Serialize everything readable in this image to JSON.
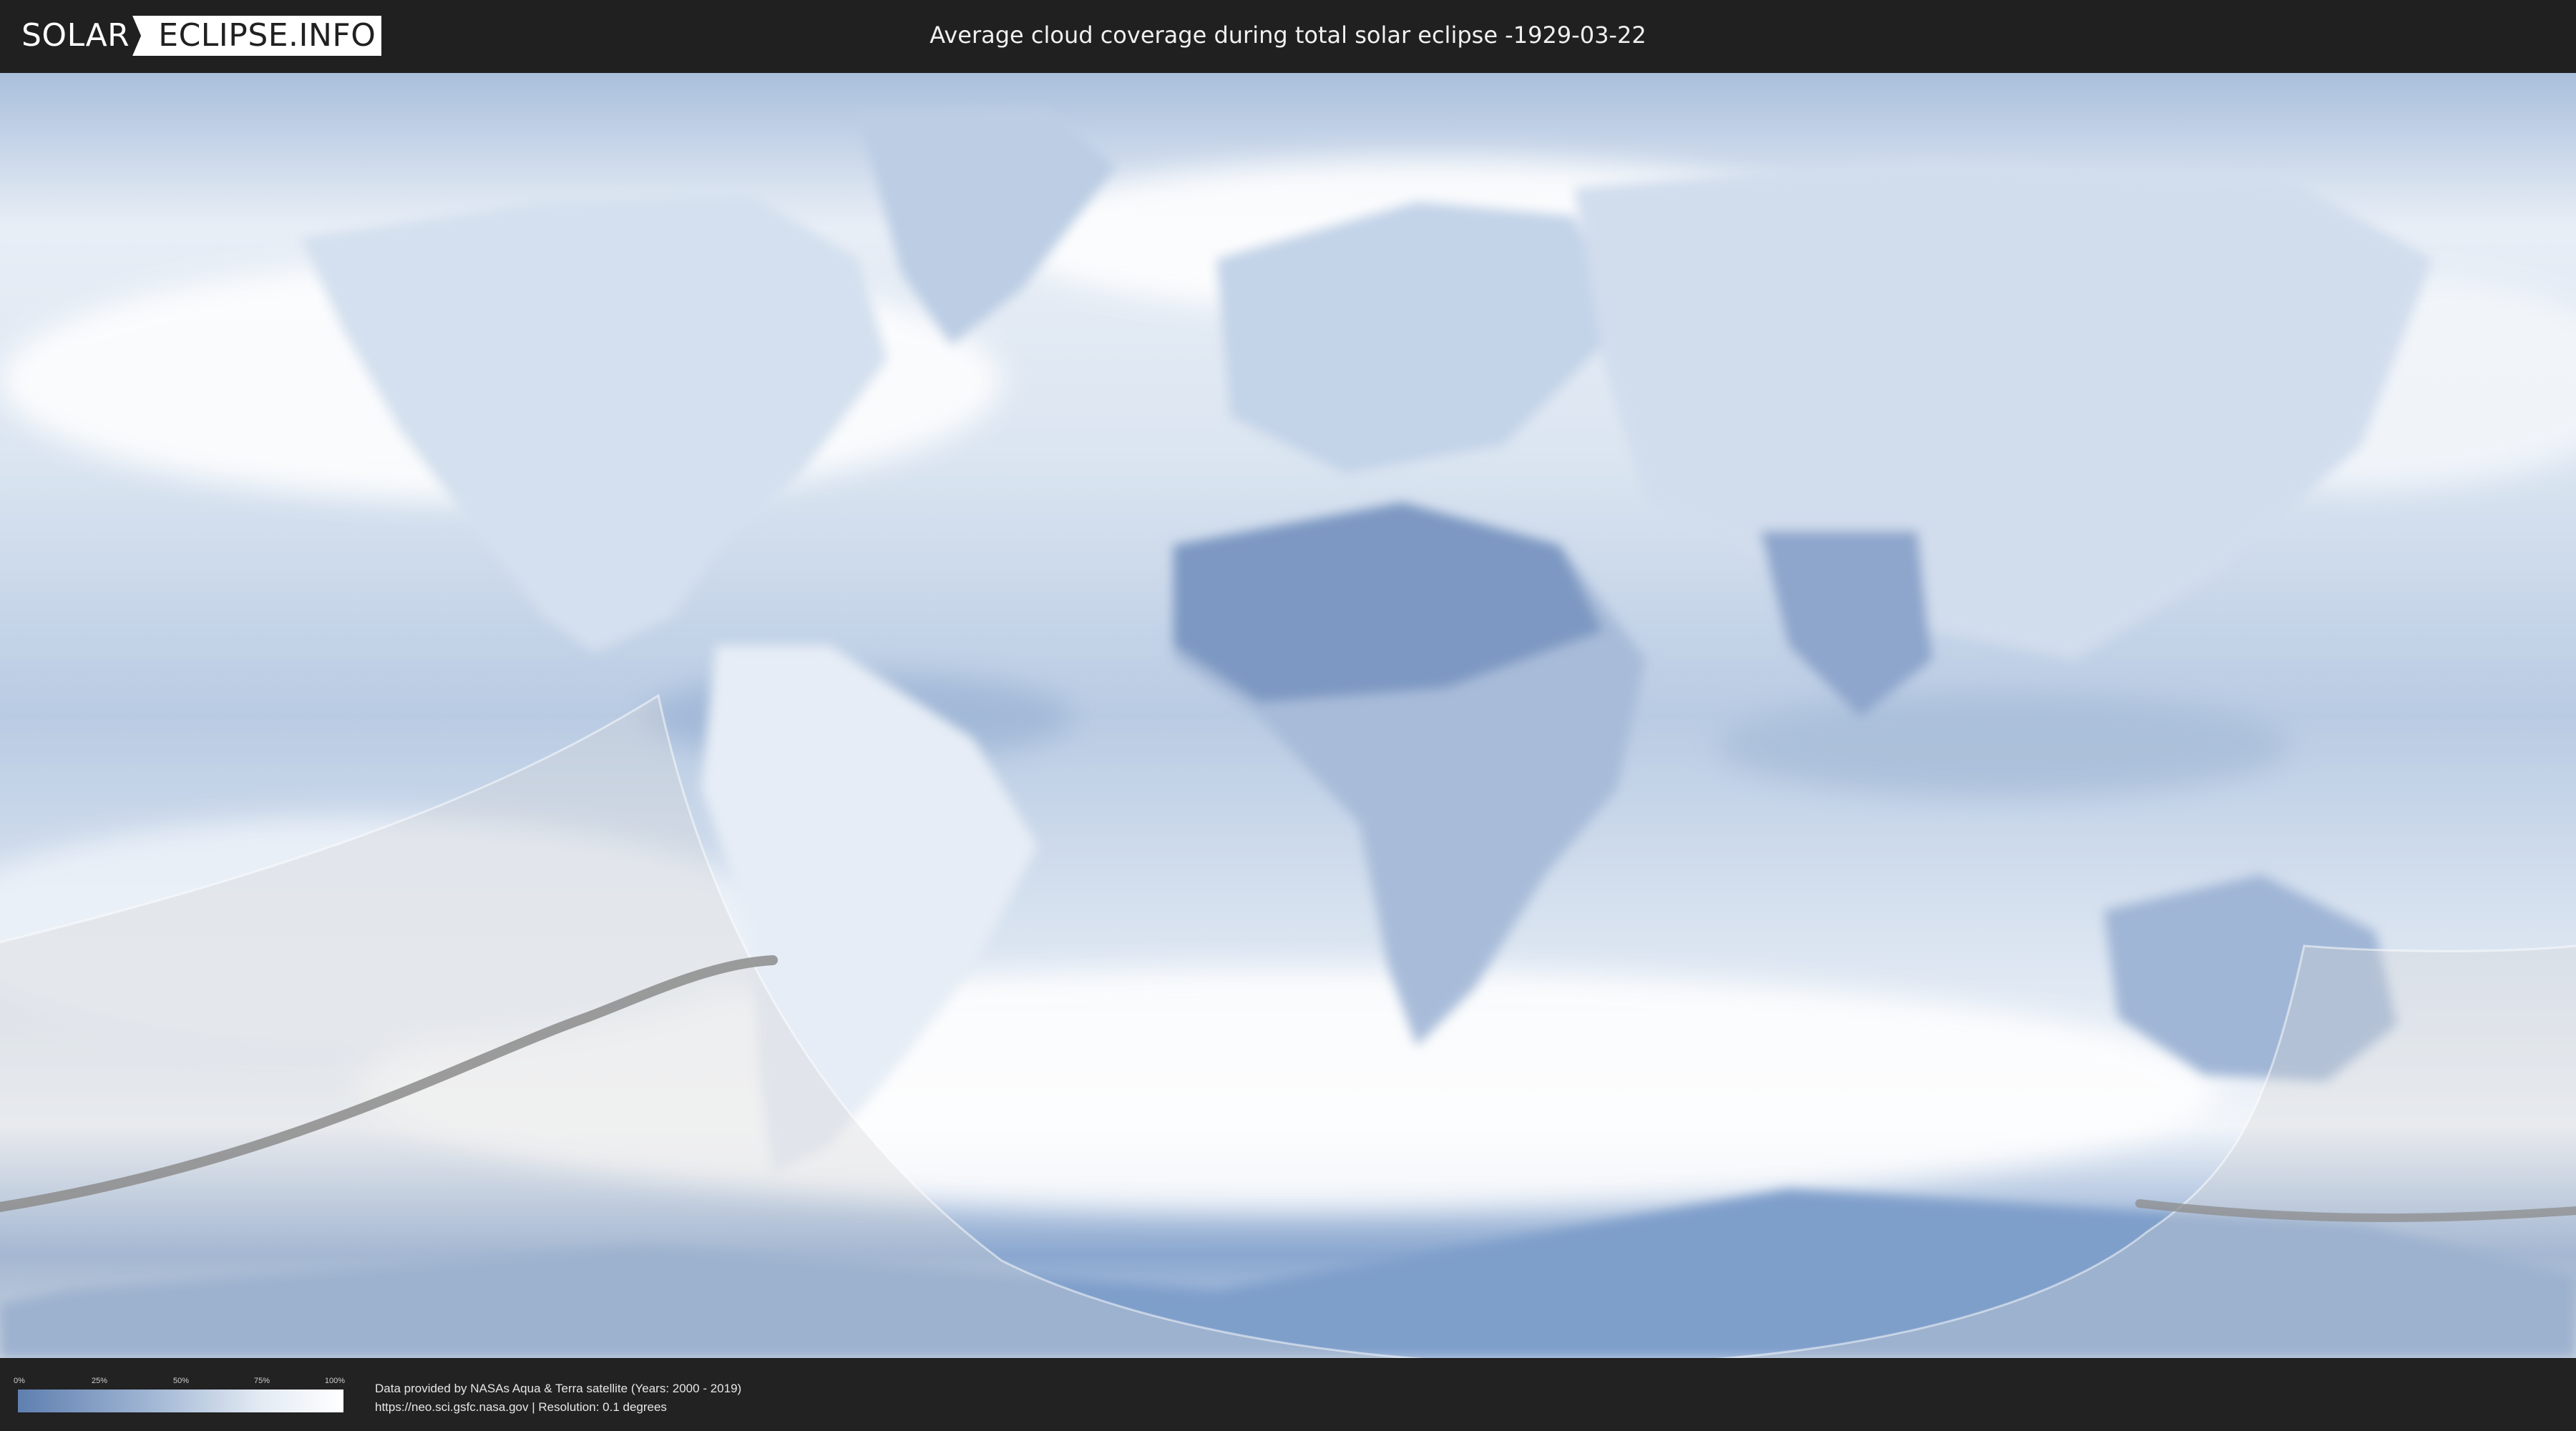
{
  "header": {
    "logo_left": "SOLAR",
    "logo_right": "ECLIPSE.INFO",
    "title": "Average cloud coverage during total solar eclipse -1929-03-22"
  },
  "colors": {
    "background": "#202020",
    "cloud_low": "#5f7fb0",
    "cloud_high": "#ffffff",
    "eclipse_path": "#8c8c8c",
    "visibility_zone": "#d8d8d8"
  },
  "scale": {
    "ticks": [
      "0%",
      "25%",
      "50%",
      "75%",
      "100%"
    ]
  },
  "credits": {
    "line1": "Data provided by NASAs Aqua & Terra satellite (Years: 2000 - 2019)",
    "line2": "https://neo.sci.gsfc.nasa.gov | Resolution: 0.1 degrees"
  }
}
